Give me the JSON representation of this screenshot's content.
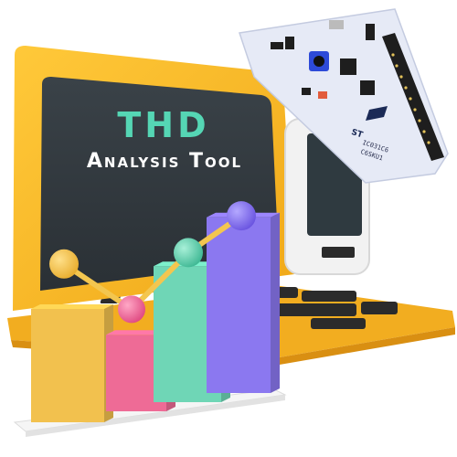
{
  "title": {
    "main": "THD",
    "subtitle": "Analysis Tool"
  },
  "board": {
    "brand": "ST",
    "chip_code_1": "IC031C6",
    "chip_code_2": "C6SKU1"
  },
  "colors": {
    "screen_frame": "#f7b928",
    "screen_bg": "#2f363c",
    "title_accent": "#55d6b4",
    "bar_yellow": "#f2c14e",
    "bar_pink": "#ee6b96",
    "bar_teal": "#6fd6b6",
    "bar_purple": "#8b78f0",
    "board_pcb": "#e6eaf6",
    "keyboard": "#2b2b2b"
  },
  "chart_data": {
    "type": "bar",
    "categories": [
      "",
      "",
      "",
      ""
    ],
    "values": [
      4,
      2.7,
      4.8,
      6.2
    ],
    "line_values": [
      5.2,
      3.6,
      5.6,
      6.9
    ],
    "ylim": [
      0,
      8
    ],
    "grid": false,
    "title": ""
  }
}
